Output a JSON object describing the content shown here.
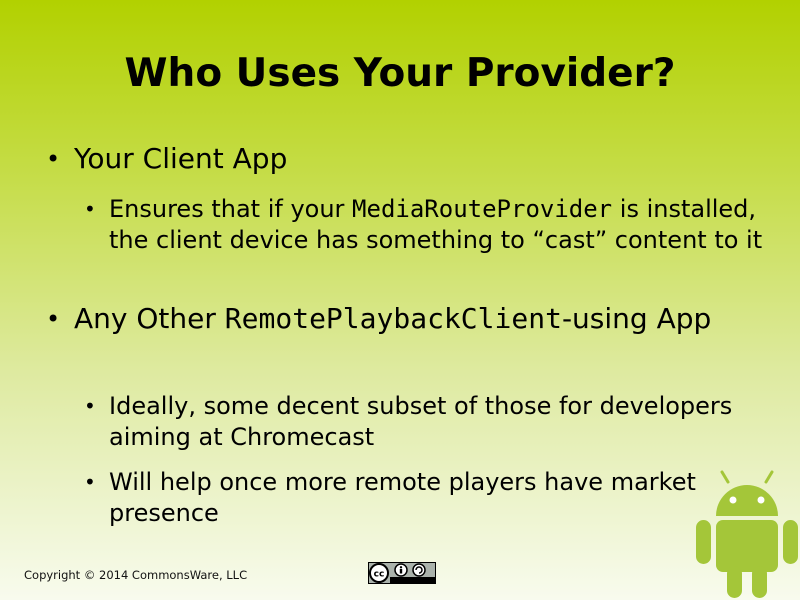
{
  "slide": {
    "title": "Who Uses Your Provider?",
    "bullets": [
      {
        "text": "Your Client App",
        "sub": [
          {
            "before": "Ensures that if your ",
            "code": "MediaRouteProvider",
            "after": " is installed, the client device has something to “cast” content to it"
          }
        ]
      },
      {
        "before": "Any Other ",
        "code": "RemotePlaybackClient",
        "after": "-using App",
        "sub": [
          {
            "text": "Ideally, some decent subset of those for developers aiming at Chromecast"
          },
          {
            "text": "Will help once more remote players have market presence"
          }
        ]
      }
    ]
  },
  "footer": {
    "copyright": "Copyright © 2014 CommonsWare, LLC"
  },
  "colors": {
    "android_green": "#a4c639"
  },
  "icons": {
    "license": "cc-by-sa-icon",
    "mascot": "android-robot-icon"
  }
}
